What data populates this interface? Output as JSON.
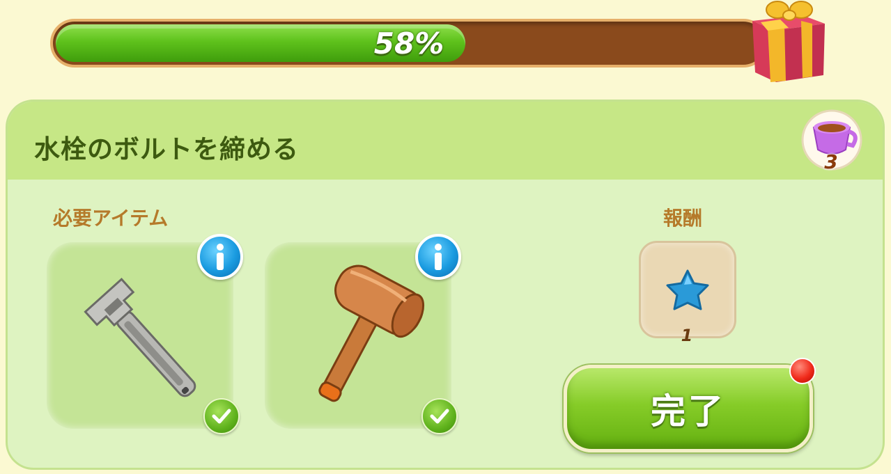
{
  "progress": {
    "value_percent": 58,
    "label": "58%"
  },
  "task": {
    "title": "水栓のボルトを締める",
    "cup_count": "3"
  },
  "required": {
    "label": "必要アイテム",
    "items": [
      {
        "icon": "wrench-icon",
        "status": "check"
      },
      {
        "icon": "mallet-icon",
        "status": "check"
      }
    ]
  },
  "reward": {
    "label": "報酬",
    "icon": "blue-star-icon",
    "count": "1"
  },
  "buttons": {
    "complete": "完了"
  },
  "colors": {
    "progress_fill": "#5fc21c",
    "progress_track": "#8a4a1c",
    "panel": "#def3c1",
    "header": "#c6e786",
    "button": "#86cc28",
    "notify": "#f02a1a"
  }
}
